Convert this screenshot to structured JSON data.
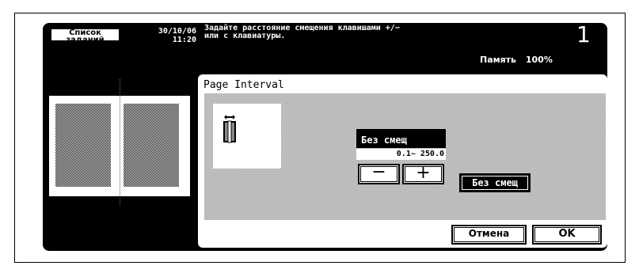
{
  "header": {
    "jobs_button_line1": "Список",
    "jobs_button_line2": "заданий",
    "date": "30/10/06",
    "time": "11:20",
    "message_line1": "Задайте расстояние смещения клавишами +/−",
    "message_line2": "или с клавиатуры.",
    "memory_label": "Память",
    "memory_value": "100%",
    "counter": "1"
  },
  "dialog": {
    "title": "Page Interval",
    "offset_label": "Без смещ",
    "range": "0.1~ 250.0",
    "minus_label": "−",
    "plus_label": "+",
    "no_offset_label": "Без смещ",
    "cancel_label": "Отмена",
    "ok_label": "OK"
  },
  "icons": {
    "page_interval": "page-interval-icon"
  }
}
